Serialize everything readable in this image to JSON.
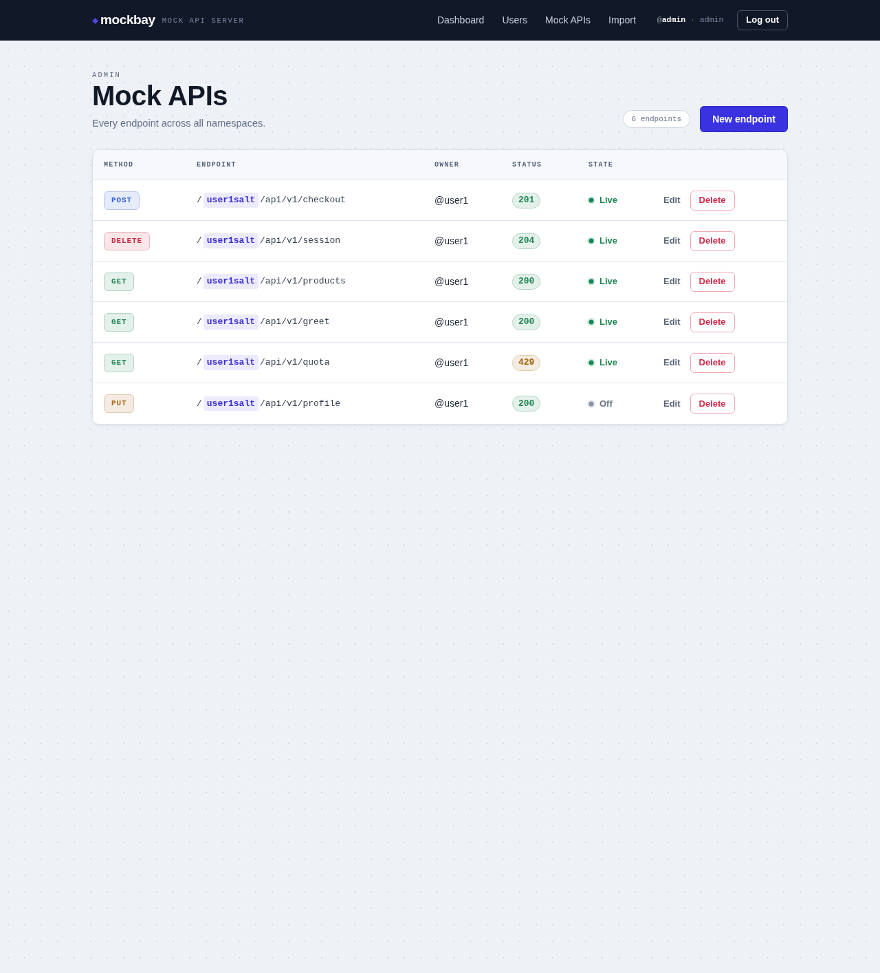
{
  "header": {
    "logo": "mockbay",
    "tagline": "MOCK API SERVER",
    "nav": [
      "Dashboard",
      "Users",
      "Mock APIs",
      "Import"
    ],
    "user_handle": "@**admin**",
    "separator": "·",
    "user_role": "admin",
    "logout": "Log out"
  },
  "page": {
    "eyebrow": "ADMIN",
    "title": "Mock APIs",
    "subtitle": "Every endpoint across all namespaces.",
    "count": "6 endpoints",
    "new_button": "New endpoint"
  },
  "table": {
    "columns": [
      "METHOD",
      "ENDPOINT",
      "OWNER",
      "STATUS",
      "STATE"
    ],
    "rows": [
      {
        "method": {
          "label": "POST",
          "color": "#2d5bd8"
        },
        "endpoint": {
          "prefix": "/",
          "namespace": "user1salt",
          "path": "/api/v1/checkout"
        },
        "owner": "@user1",
        "status": {
          "code": "201",
          "color": "#1f8552"
        },
        "state": {
          "label": "Live",
          "live": true
        },
        "edit": "Edit",
        "delete": "Delete"
      },
      {
        "method": {
          "label": "DELETE",
          "color": "#c62c43"
        },
        "endpoint": {
          "prefix": "/",
          "namespace": "user1salt",
          "path": "/api/v1/session"
        },
        "owner": "@user1",
        "status": {
          "code": "204",
          "color": "#1f8552"
        },
        "state": {
          "label": "Live",
          "live": true
        },
        "edit": "Edit",
        "delete": "Delete"
      },
      {
        "method": {
          "label": "GET",
          "color": "#1f8552"
        },
        "endpoint": {
          "prefix": "/",
          "namespace": "user1salt",
          "path": "/api/v1/products"
        },
        "owner": "@user1",
        "status": {
          "code": "200",
          "color": "#1f8552"
        },
        "state": {
          "label": "Live",
          "live": true
        },
        "edit": "Edit",
        "delete": "Delete"
      },
      {
        "method": {
          "label": "GET",
          "color": "#1f8552"
        },
        "endpoint": {
          "prefix": "/",
          "namespace": "user1salt",
          "path": "/api/v1/greet"
        },
        "owner": "@user1",
        "status": {
          "code": "200",
          "color": "#1f8552"
        },
        "state": {
          "label": "Live",
          "live": true
        },
        "edit": "Edit",
        "delete": "Delete"
      },
      {
        "method": {
          "label": "GET",
          "color": "#1f8552"
        },
        "endpoint": {
          "prefix": "/",
          "namespace": "user1salt",
          "path": "/api/v1/quota"
        },
        "owner": "@user1",
        "status": {
          "code": "429",
          "color": "#a5630f"
        },
        "state": {
          "label": "Live",
          "live": true
        },
        "edit": "Edit",
        "delete": "Delete"
      },
      {
        "method": {
          "label": "PUT",
          "color": "#a5630f"
        },
        "endpoint": {
          "prefix": "/",
          "namespace": "user1salt",
          "path": "/api/v1/profile"
        },
        "owner": "@user1",
        "status": {
          "code": "200",
          "color": "#1f8552"
        },
        "state": {
          "label": "Off",
          "live": false
        },
        "edit": "Edit",
        "delete": "Delete"
      }
    ]
  }
}
